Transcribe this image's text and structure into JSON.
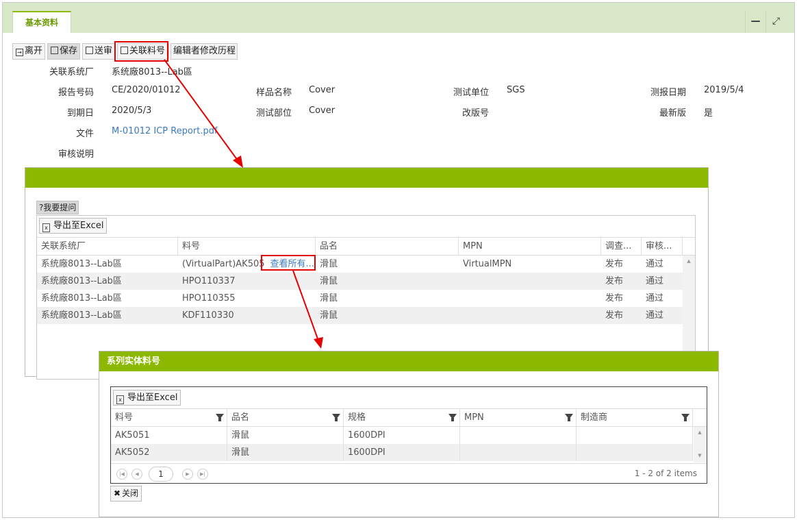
{
  "tab": {
    "label": "基本资料"
  },
  "window_controls": {
    "minimize": "—",
    "maximize": "⤢"
  },
  "toolbar": {
    "leave": "离开",
    "save": "保存",
    "submit": "送审",
    "link_parts": "关联料号",
    "edit_history": "编辑者修改历程"
  },
  "form": {
    "factory_label": "关联系统厂",
    "factory_value": "系统廠8013--Lab區",
    "report_no_label": "报告号码",
    "report_no_value": "CE/2020/01012",
    "sample_name_label": "样品名称",
    "sample_name_value": "Cover",
    "test_unit_label": "测试单位",
    "test_unit_value": "SGS",
    "report_date_label": "测报日期",
    "report_date_value": "2019/5/4",
    "expiry_label": "到期日",
    "expiry_value": "2020/5/3",
    "test_part_label": "测试部位",
    "test_part_value": "Cover",
    "revision_label": "改版号",
    "revision_value": "",
    "latest_label": "最新版",
    "latest_value": "是",
    "file_label": "文件",
    "file_value": "M-01012 ICP Report.pdf",
    "review_label": "审核说明",
    "review_value": ""
  },
  "dialog1": {
    "ask_button": "?我要提问",
    "export_button": "导出至Excel",
    "columns": [
      "关联系统厂",
      "料号",
      "品名",
      "MPN",
      "调查...",
      "审核..."
    ],
    "view_all_link": "查看所有...",
    "rows": [
      [
        "系统廠8013--Lab區",
        "(VirtualPart)AK505",
        "滑鼠",
        "VirtualMPN",
        "发布",
        "通过"
      ],
      [
        "系统廠8013--Lab區",
        "HPO110337",
        "滑鼠",
        "",
        "发布",
        "通过"
      ],
      [
        "系统廠8013--Lab區",
        "HPO110355",
        "滑鼠",
        "",
        "发布",
        "通过"
      ],
      [
        "系统廠8013--Lab區",
        "KDF110330",
        "滑鼠",
        "",
        "发布",
        "通过"
      ]
    ]
  },
  "dialog2": {
    "title": "系列实体料号",
    "export_button": "导出至Excel",
    "columns": [
      "料号",
      "品名",
      "规格",
      "MPN",
      "制造商"
    ],
    "rows": [
      [
        "AK5051",
        "滑鼠",
        "1600DPI",
        "",
        ""
      ],
      [
        "AK5052",
        "滑鼠",
        "1600DPI",
        "",
        ""
      ]
    ],
    "pager": {
      "page": "1",
      "info": "1 - 2 of 2 items"
    },
    "close_button": "关闭"
  },
  "colors": {
    "accent_green": "#8cb800",
    "highlight_red": "#e60000",
    "link_blue": "#3a7ac0"
  }
}
